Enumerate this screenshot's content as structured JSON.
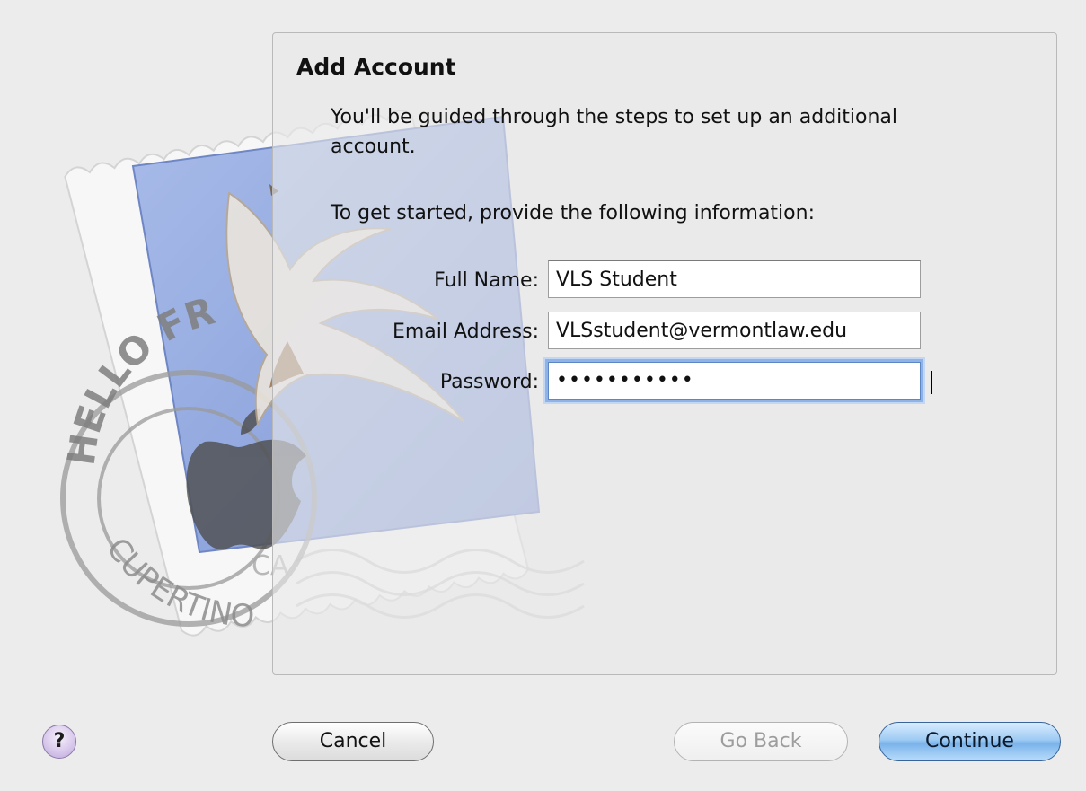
{
  "dialog": {
    "title": "Add Account",
    "intro": "You'll be guided through the steps to set up an additional account.",
    "prompt": "To get started, provide the following information:"
  },
  "form": {
    "full_name_label": "Full Name:",
    "full_name_value": "VLS Student",
    "email_label": "Email Address:",
    "email_value": "VLSstudent@vermontlaw.edu",
    "password_label": "Password:",
    "password_masked": "•••••••••••"
  },
  "artwork": {
    "stamp_top_text": "HELLO FR",
    "stamp_bottom_text": "CUPERTINO",
    "stamp_bottom_suffix": "CA",
    "icon": "mail-stamp-eagle-icon"
  },
  "buttons": {
    "help_label": "?",
    "cancel_label": "Cancel",
    "go_back_label": "Go Back",
    "continue_label": "Continue"
  },
  "colors": {
    "window_background": "#ececec",
    "stamp_blue": "#8fa6dd",
    "continue_blue": "#79b3ea",
    "focus_ring": "#8fb3e6"
  }
}
